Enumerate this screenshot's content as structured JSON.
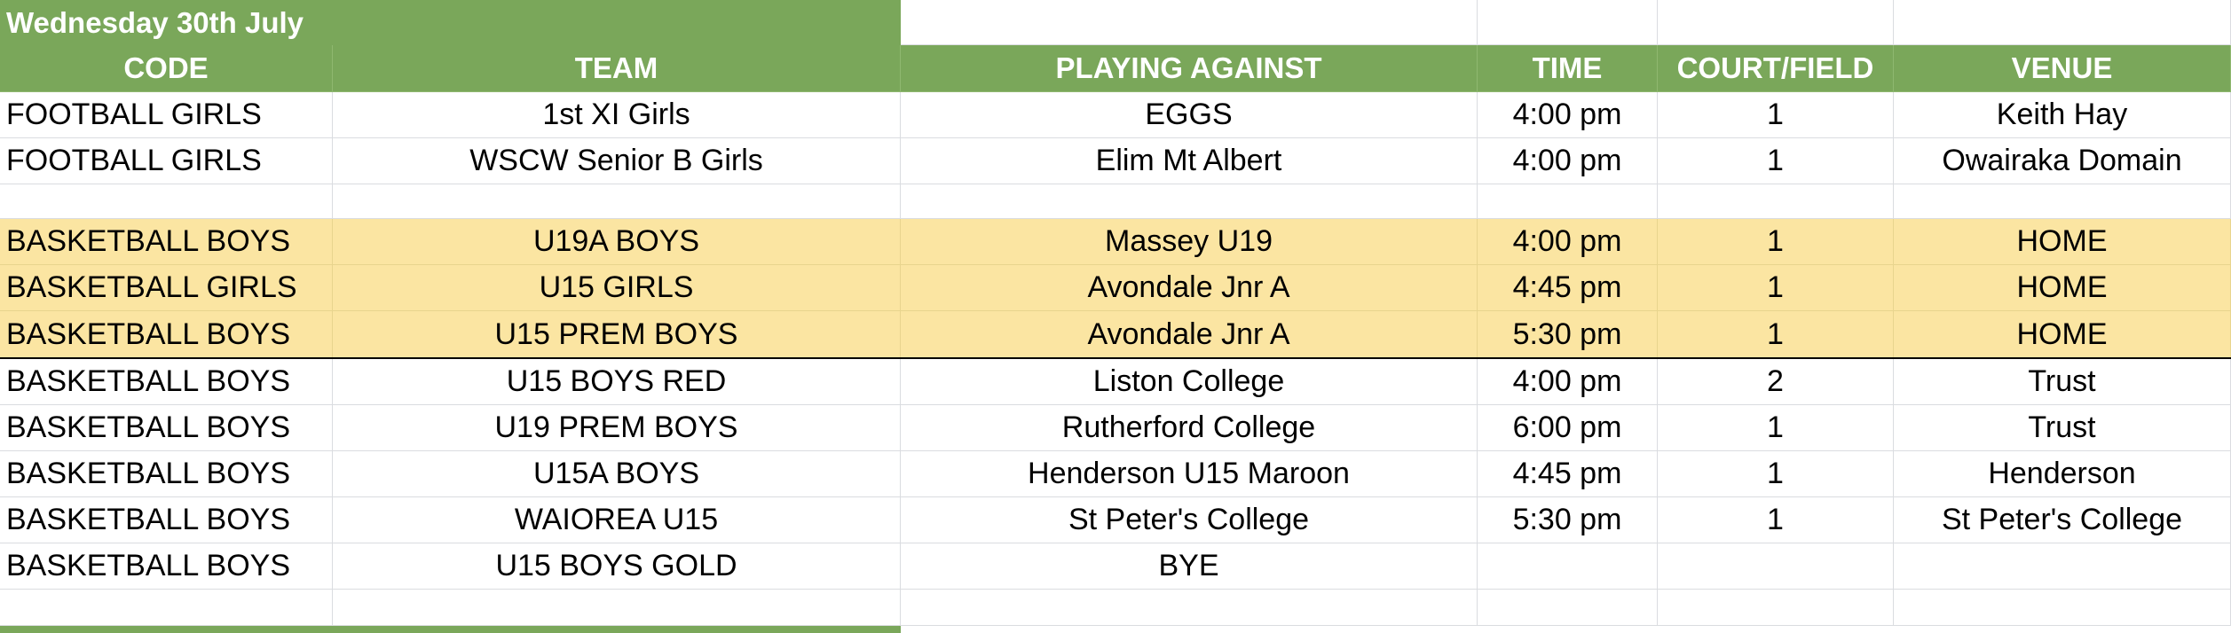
{
  "sheet": {
    "title": "Wednesday 30th July",
    "headers": [
      "CODE",
      "TEAM",
      "PLAYING AGAINST",
      "TIME",
      "COURT/FIELD",
      "VENUE"
    ],
    "rows": [
      {
        "code": "FOOTBALL GIRLS",
        "team": "1st XI Girls",
        "against": "EGGS",
        "time": "4:00 pm",
        "court": "1",
        "venue": "Keith Hay",
        "highlight": false
      },
      {
        "code": "FOOTBALL GIRLS",
        "team": "WSCW Senior B Girls",
        "against": "Elim Mt Albert",
        "time": "4:00 pm",
        "court": "1",
        "venue": "Owairaka Domain",
        "highlight": false
      },
      {
        "code": "",
        "team": "",
        "against": "",
        "time": "",
        "court": "",
        "venue": "",
        "highlight": false
      },
      {
        "code": "BASKETBALL BOYS",
        "team": "U19A BOYS",
        "against": "Massey U19",
        "time": "4:00 pm",
        "court": "1",
        "venue": "HOME",
        "highlight": true
      },
      {
        "code": "BASKETBALL GIRLS",
        "team": "U15 GIRLS",
        "against": "Avondale Jnr A",
        "time": "4:45 pm",
        "court": "1",
        "venue": "HOME",
        "highlight": true
      },
      {
        "code": "BASKETBALL BOYS",
        "team": "U15 PREM BOYS",
        "against": "Avondale Jnr A",
        "time": "5:30 pm",
        "court": "1",
        "venue": "HOME",
        "highlight": true
      },
      {
        "code": "BASKETBALL BOYS",
        "team": "U15 BOYS RED",
        "against": "Liston College",
        "time": "4:00 pm",
        "court": "2",
        "venue": "Trust",
        "highlight": false
      },
      {
        "code": "BASKETBALL BOYS",
        "team": "U19 PREM BOYS",
        "against": "Rutherford College",
        "time": "6:00 pm",
        "court": "1",
        "venue": "Trust",
        "highlight": false
      },
      {
        "code": "BASKETBALL BOYS",
        "team": "U15A BOYS",
        "against": "Henderson U15 Maroon",
        "time": "4:45 pm",
        "court": "1",
        "venue": "Henderson",
        "highlight": false
      },
      {
        "code": "BASKETBALL BOYS",
        "team": "WAIOREA U15",
        "against": "St Peter's College",
        "time": "5:30 pm",
        "court": "1",
        "venue": "St Peter's College",
        "highlight": false
      },
      {
        "code": "BASKETBALL BOYS",
        "team": "U15 BOYS GOLD",
        "against": "BYE",
        "time": "",
        "court": "",
        "venue": "",
        "highlight": false
      },
      {
        "code": "",
        "team": "",
        "against": "",
        "time": "",
        "court": "",
        "venue": "",
        "highlight": false
      }
    ]
  },
  "colors": {
    "header_green": "#7aa75a",
    "highlight_yellow": "#fbe5a2",
    "gridline": "#dadce0"
  }
}
